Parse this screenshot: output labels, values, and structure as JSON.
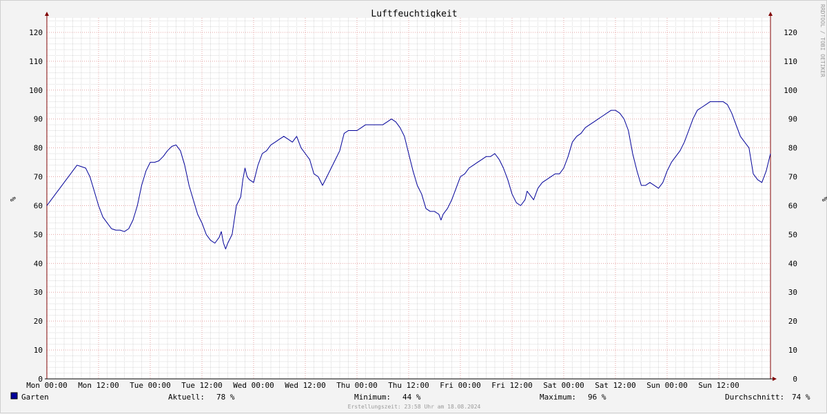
{
  "chart_data": {
    "type": "line",
    "title": "Luftfeuchtigkeit",
    "ylabel": "%",
    "ylabel_right": "%",
    "ylim": [
      0,
      125
    ],
    "yticks": [
      0,
      10,
      20,
      30,
      40,
      50,
      60,
      70,
      80,
      90,
      100,
      110,
      120
    ],
    "xlim_hours": [
      0,
      168
    ],
    "xticks": [
      {
        "h": 0,
        "label": "Mon 00:00"
      },
      {
        "h": 12,
        "label": "Mon 12:00"
      },
      {
        "h": 24,
        "label": "Tue 00:00"
      },
      {
        "h": 36,
        "label": "Tue 12:00"
      },
      {
        "h": 48,
        "label": "Wed 00:00"
      },
      {
        "h": 60,
        "label": "Wed 12:00"
      },
      {
        "h": 72,
        "label": "Thu 00:00"
      },
      {
        "h": 84,
        "label": "Thu 12:00"
      },
      {
        "h": 96,
        "label": "Fri 00:00"
      },
      {
        "h": 108,
        "label": "Fri 12:00"
      },
      {
        "h": 120,
        "label": "Sat 00:00"
      },
      {
        "h": 132,
        "label": "Sat 12:00"
      },
      {
        "h": 144,
        "label": "Sun 00:00"
      },
      {
        "h": 156,
        "label": "Sun 12:00"
      }
    ],
    "grid": true,
    "series": [
      {
        "name": "Garten",
        "color": "#000099",
        "points": [
          [
            0,
            60
          ],
          [
            1,
            62
          ],
          [
            2,
            64
          ],
          [
            3,
            66
          ],
          [
            4,
            68
          ],
          [
            5,
            70
          ],
          [
            6,
            72
          ],
          [
            7,
            74
          ],
          [
            8,
            73.5
          ],
          [
            9,
            73
          ],
          [
            10,
            70
          ],
          [
            11,
            65
          ],
          [
            12,
            60
          ],
          [
            13,
            56
          ],
          [
            14,
            54
          ],
          [
            15,
            52
          ],
          [
            16,
            51.5
          ],
          [
            17,
            51.5
          ],
          [
            18,
            51
          ],
          [
            19,
            52
          ],
          [
            20,
            55
          ],
          [
            21,
            60
          ],
          [
            22,
            67
          ],
          [
            23,
            72
          ],
          [
            24,
            75
          ],
          [
            25,
            75
          ],
          [
            26,
            75.5
          ],
          [
            27,
            77
          ],
          [
            28,
            79
          ],
          [
            29,
            80.5
          ],
          [
            30,
            81
          ],
          [
            31,
            79
          ],
          [
            32,
            74
          ],
          [
            33,
            67
          ],
          [
            34,
            62
          ],
          [
            35,
            57
          ],
          [
            36,
            54
          ],
          [
            37,
            50
          ],
          [
            38,
            48
          ],
          [
            39,
            47
          ],
          [
            40,
            49
          ],
          [
            40.5,
            51
          ],
          [
            41,
            47
          ],
          [
            41.5,
            45
          ],
          [
            42,
            47
          ],
          [
            43,
            50
          ],
          [
            44,
            60
          ],
          [
            45,
            63
          ],
          [
            45.5,
            69
          ],
          [
            46,
            73
          ],
          [
            46.5,
            70
          ],
          [
            47,
            69
          ],
          [
            48,
            68
          ],
          [
            49,
            74
          ],
          [
            50,
            78
          ],
          [
            51,
            79
          ],
          [
            52,
            81
          ],
          [
            53,
            82
          ],
          [
            54,
            83
          ],
          [
            55,
            84
          ],
          [
            56,
            83
          ],
          [
            57,
            82
          ],
          [
            58,
            84
          ],
          [
            59,
            80
          ],
          [
            60,
            78
          ],
          [
            61,
            76
          ],
          [
            62,
            71
          ],
          [
            63,
            70
          ],
          [
            64,
            67
          ],
          [
            65,
            70
          ],
          [
            66,
            73
          ],
          [
            67,
            76
          ],
          [
            68,
            79
          ],
          [
            69,
            85
          ],
          [
            70,
            86
          ],
          [
            71,
            86
          ],
          [
            72,
            86
          ],
          [
            73,
            87
          ],
          [
            74,
            88
          ],
          [
            75,
            88
          ],
          [
            76,
            88
          ],
          [
            77,
            88
          ],
          [
            78,
            88
          ],
          [
            79,
            89
          ],
          [
            80,
            90
          ],
          [
            81,
            89
          ],
          [
            82,
            87
          ],
          [
            83,
            84
          ],
          [
            84,
            78
          ],
          [
            85,
            72
          ],
          [
            86,
            67
          ],
          [
            87,
            64
          ],
          [
            88,
            59
          ],
          [
            89,
            58
          ],
          [
            90,
            58
          ],
          [
            91,
            57
          ],
          [
            91.5,
            55
          ],
          [
            92,
            57
          ],
          [
            93,
            59
          ],
          [
            94,
            62
          ],
          [
            95,
            66
          ],
          [
            96,
            70
          ],
          [
            97,
            71
          ],
          [
            98,
            73
          ],
          [
            99,
            74
          ],
          [
            100,
            75
          ],
          [
            101,
            76
          ],
          [
            102,
            77
          ],
          [
            103,
            77
          ],
          [
            104,
            78
          ],
          [
            105,
            76
          ],
          [
            106,
            73
          ],
          [
            107,
            69
          ],
          [
            108,
            64
          ],
          [
            109,
            61
          ],
          [
            110,
            60
          ],
          [
            111,
            62
          ],
          [
            111.5,
            65
          ],
          [
            112,
            64
          ],
          [
            113,
            62
          ],
          [
            114,
            66
          ],
          [
            115,
            68
          ],
          [
            116,
            69
          ],
          [
            117,
            70
          ],
          [
            118,
            71
          ],
          [
            119,
            71
          ],
          [
            120,
            73
          ],
          [
            121,
            77
          ],
          [
            122,
            82
          ],
          [
            123,
            84
          ],
          [
            124,
            85
          ],
          [
            125,
            87
          ],
          [
            126,
            88
          ],
          [
            127,
            89
          ],
          [
            128,
            90
          ],
          [
            129,
            91
          ],
          [
            130,
            92
          ],
          [
            131,
            93
          ],
          [
            132,
            93
          ],
          [
            133,
            92
          ],
          [
            134,
            90
          ],
          [
            135,
            86
          ],
          [
            136,
            78
          ],
          [
            137,
            72
          ],
          [
            138,
            67
          ],
          [
            139,
            67
          ],
          [
            140,
            68
          ],
          [
            141,
            67
          ],
          [
            142,
            66
          ],
          [
            143,
            68
          ],
          [
            144,
            72
          ],
          [
            145,
            75
          ],
          [
            146,
            77
          ],
          [
            147,
            79
          ],
          [
            148,
            82
          ],
          [
            149,
            86
          ],
          [
            150,
            90
          ],
          [
            151,
            93
          ],
          [
            152,
            94
          ],
          [
            153,
            95
          ],
          [
            154,
            96
          ],
          [
            155,
            96
          ],
          [
            156,
            96
          ],
          [
            157,
            96
          ],
          [
            158,
            95
          ],
          [
            159,
            92
          ],
          [
            160,
            88
          ],
          [
            161,
            84
          ],
          [
            162,
            82
          ],
          [
            163,
            80
          ],
          [
            164,
            71
          ],
          [
            165,
            69
          ],
          [
            166,
            68
          ],
          [
            167,
            72
          ],
          [
            168,
            78
          ]
        ]
      }
    ],
    "legend": {
      "marker_color": "#000099",
      "label": "Garten"
    },
    "stats": [
      {
        "label": "Aktuell:",
        "value": "78 %"
      },
      {
        "label": "Minimum:",
        "value": "44 %"
      },
      {
        "label": "Maximum:",
        "value": "96 %"
      },
      {
        "label": "Durchschnitt:",
        "value": "74 %"
      }
    ],
    "footer": "Erstellungszeit: 23:58 Uhr am 18.08.2024",
    "watermark": "RRDTOOL / TOBI OETIKER",
    "colors": {
      "grid_major": "#e4a0a0",
      "grid_minor": "#d9d9d9",
      "plot_bg": "#ffffff",
      "axis": "#800000",
      "line": "#000099"
    }
  }
}
